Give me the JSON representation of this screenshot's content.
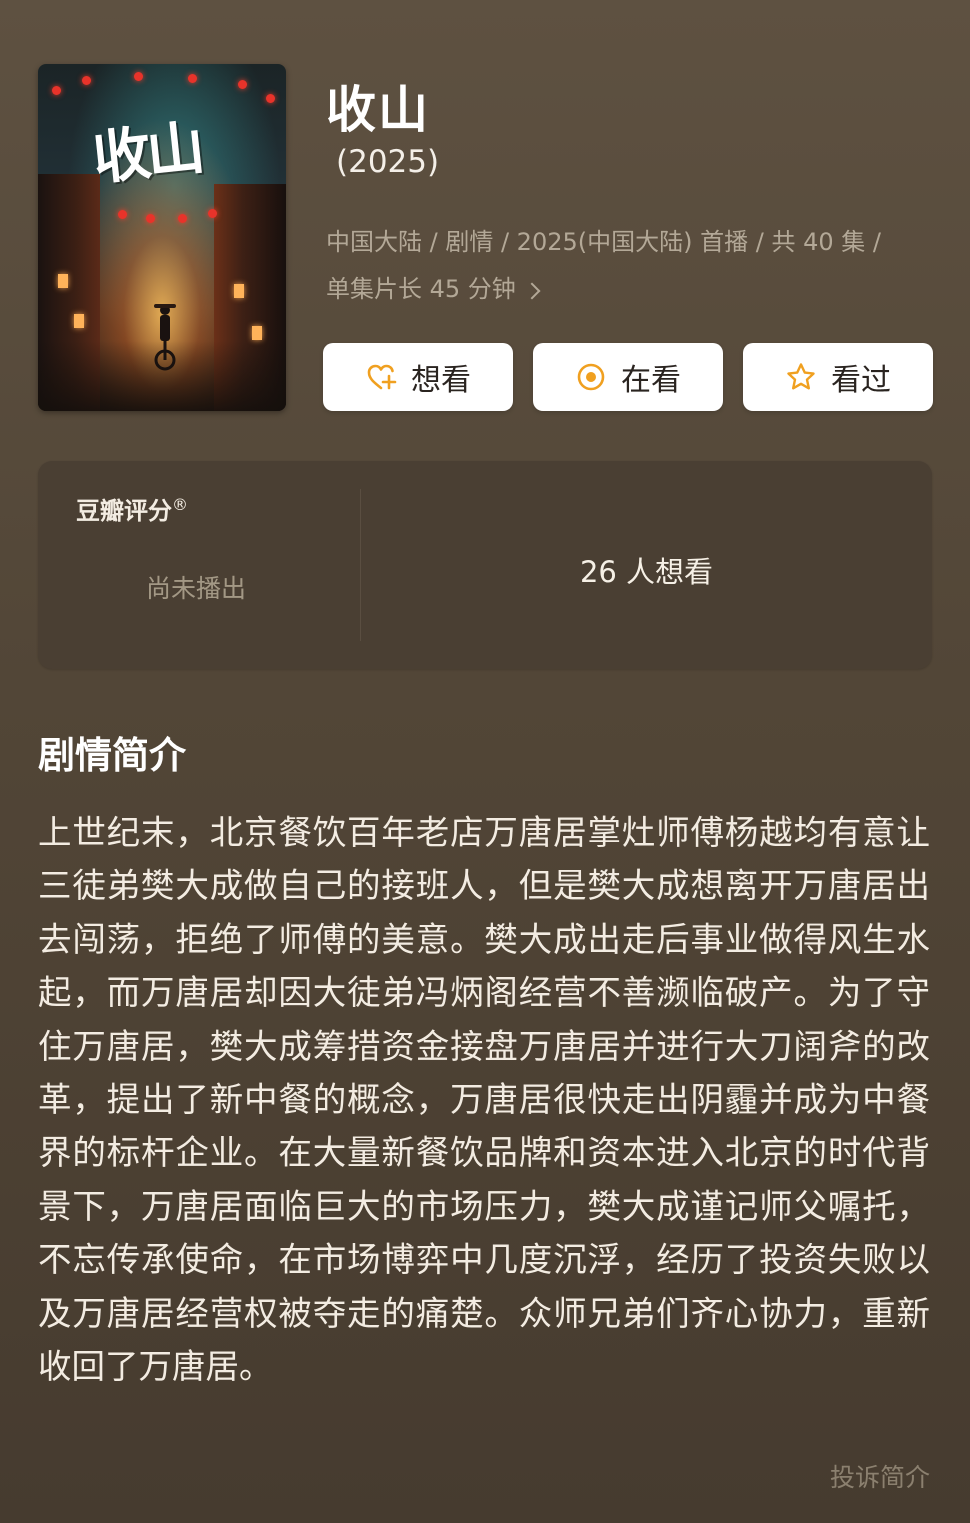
{
  "show": {
    "title": "收山",
    "year": "(2025)",
    "meta_line1": "中国大陆 / 剧情 / 2025(中国大陆) 首播 / 共 40 集 /",
    "meta_line2": "单集片长 45 分钟"
  },
  "poster": {
    "art_text": "收山"
  },
  "actions": {
    "want_label": "想看",
    "doing_label": "在看",
    "done_label": "看过"
  },
  "rating": {
    "title": "豆瓣评分",
    "title_mark": "®",
    "status": "尚未播出",
    "want_count": "26 人想看"
  },
  "synopsis": {
    "heading": "剧情简介",
    "text": "上世纪末，北京餐饮百年老店万唐居掌灶师傅杨越均有意让三徒弟樊大成做自己的接班人，但是樊大成想离开万唐居出去闯荡，拒绝了师傅的美意。樊大成出走后事业做得风生水起，而万唐居却因大徒弟冯炳阁经营不善濒临破产。为了守住万唐居，樊大成筹措资金接盘万唐居并进行大刀阔斧的改革，提出了新中餐的概念，万唐居很快走出阴霾并成为中餐界的标杆企业。在大量新餐饮品牌和资本进入北京的时代背景下，万唐居面临巨大的市场压力，樊大成谨记师父嘱托，不忘传承使命，在市场博弈中几度沉浮，经历了投资失败以及万唐居经营权被夺走的痛楚。众师兄弟们齐心协力，重新收回了万唐居。",
    "report_label": "投诉简介"
  },
  "colors": {
    "background": "#544839",
    "card": "#4a3f33",
    "accent_orange": "#f0a020",
    "muted_text": "#b3a897"
  },
  "icons": {
    "want": "heart-plus-icon",
    "doing": "target-circle-icon",
    "done": "star-icon",
    "meta_more": "chevron-right-icon"
  }
}
